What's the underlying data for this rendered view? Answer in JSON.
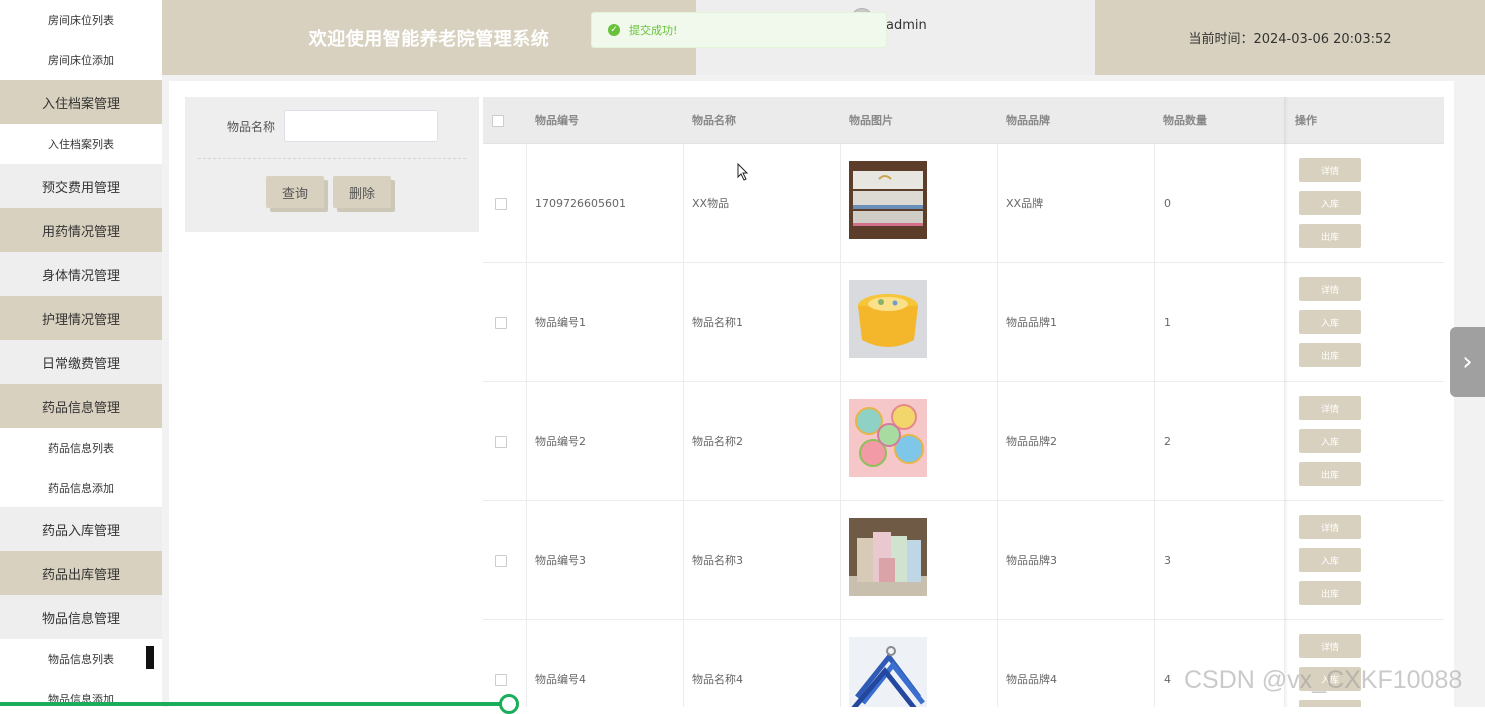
{
  "sidebar": {
    "items": [
      {
        "label": "房间床位列表",
        "type": "sub"
      },
      {
        "label": "房间床位添加",
        "type": "sub"
      },
      {
        "label": "入住档案管理",
        "type": "main"
      },
      {
        "label": "入住档案列表",
        "type": "sub"
      },
      {
        "label": "预交费用管理",
        "type": "main"
      },
      {
        "label": "用药情况管理",
        "type": "main"
      },
      {
        "label": "身体情况管理",
        "type": "main"
      },
      {
        "label": "护理情况管理",
        "type": "main"
      },
      {
        "label": "日常缴费管理",
        "type": "main"
      },
      {
        "label": "药品信息管理",
        "type": "main"
      },
      {
        "label": "药品信息列表",
        "type": "sub"
      },
      {
        "label": "药品信息添加",
        "type": "sub"
      },
      {
        "label": "药品入库管理",
        "type": "main"
      },
      {
        "label": "药品出库管理",
        "type": "main"
      },
      {
        "label": "物品信息管理",
        "type": "main"
      },
      {
        "label": "物品信息列表",
        "type": "sub"
      },
      {
        "label": "物品信息添加",
        "type": "sub"
      }
    ]
  },
  "header": {
    "title": "欢迎使用智能养老院管理系统",
    "user": "admin",
    "time_label": "当前时间：2024-03-06 20:03:52"
  },
  "toast": {
    "message": "提交成功!",
    "icon": "success-check-icon"
  },
  "search": {
    "label": "物品名称",
    "value": "",
    "query_button": "查询",
    "delete_button": "删除"
  },
  "table": {
    "headers": [
      "物品编号",
      "物品名称",
      "物品图片",
      "物品品牌",
      "物品数量",
      "操作"
    ],
    "actions": [
      "详情",
      "入库",
      "出库"
    ],
    "rows": [
      {
        "code": "1709726605601",
        "name": "XX物品",
        "brand": "XX品牌",
        "qty": "0",
        "image": "towels"
      },
      {
        "code": "物品编号1",
        "name": "物品名称1",
        "brand": "物品品牌1",
        "qty": "1",
        "image": "yellow-box"
      },
      {
        "code": "物品编号2",
        "name": "物品名称2",
        "brand": "物品品牌2",
        "qty": "2",
        "image": "fans"
      },
      {
        "code": "物品编号3",
        "name": "物品名称3",
        "brand": "物品品牌3",
        "qty": "3",
        "image": "bags"
      },
      {
        "code": "物品编号4",
        "name": "物品名称4",
        "brand": "物品品牌4",
        "qty": "4",
        "image": "hangers"
      }
    ]
  },
  "watermark": "CSDN @vx_CXKF10088",
  "colors": {
    "accent": "#d8d1bf",
    "success": "#67c23a",
    "progress": "#1aad5a"
  }
}
